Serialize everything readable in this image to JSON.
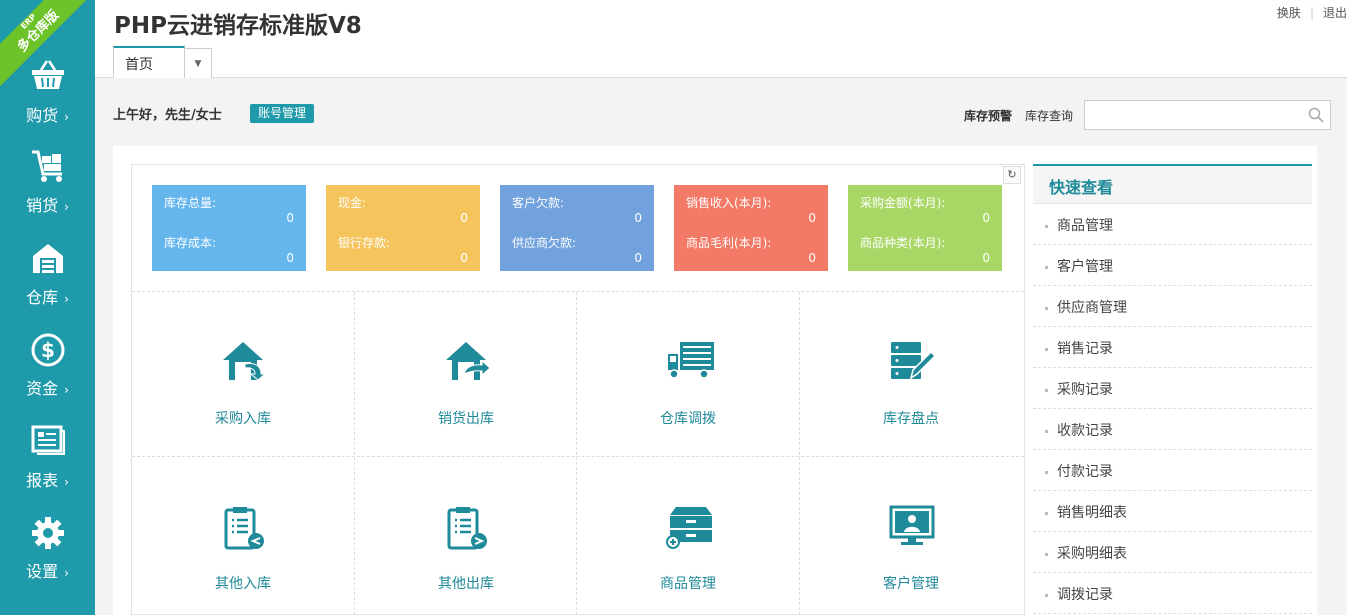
{
  "app": {
    "title": "PHP云进销存标准版V8"
  },
  "ribbon": {
    "small": "ERP",
    "big": "多仓库版"
  },
  "sidebar": {
    "items": [
      {
        "label": "购货",
        "icon": "basket-icon"
      },
      {
        "label": "销货",
        "icon": "cart-icon"
      },
      {
        "label": "仓库",
        "icon": "warehouse-icon"
      },
      {
        "label": "资金",
        "icon": "dollar-icon"
      },
      {
        "label": "报表",
        "icon": "report-icon"
      },
      {
        "label": "设置",
        "icon": "gear-icon"
      }
    ]
  },
  "header": {
    "skin": "换肤",
    "logout": "退出"
  },
  "tabs": {
    "home": "首页"
  },
  "greeting": {
    "text": "上午好，先生/女士",
    "account": "账号管理"
  },
  "stock": {
    "warning": "库存预警",
    "query_label": "库存查询",
    "query_value": ""
  },
  "stats": [
    {
      "label1": "库存总量:",
      "value1": "0",
      "label2": "库存成本:",
      "value2": "0",
      "color": "#66b6ee"
    },
    {
      "label1": "现金:",
      "value1": "0",
      "label2": "银行存款:",
      "value2": "0",
      "color": "#f5c45c"
    },
    {
      "label1": "客户欠款:",
      "value1": "0",
      "label2": "供应商欠款:",
      "value2": "0",
      "color": "#71a2dd"
    },
    {
      "label1": "销售收入(本月):",
      "value1": "0",
      "label2": "商品毛利(本月):",
      "value2": "0",
      "color": "#f27a67"
    },
    {
      "label1": "采购金额(本月):",
      "value1": "0",
      "label2": "商品种类(本月):",
      "value2": "0",
      "color": "#a9d766"
    }
  ],
  "shortcuts": [
    {
      "label": "采购入库",
      "icon": "purchase-in-icon"
    },
    {
      "label": "销货出库",
      "icon": "sales-out-icon"
    },
    {
      "label": "仓库调拨",
      "icon": "truck-icon"
    },
    {
      "label": "库存盘点",
      "icon": "inventory-check-icon"
    },
    {
      "label": "其他入库",
      "icon": "clipboard-in-icon"
    },
    {
      "label": "其他出库",
      "icon": "clipboard-out-icon"
    },
    {
      "label": "商品管理",
      "icon": "product-box-icon"
    },
    {
      "label": "客户管理",
      "icon": "customer-monitor-icon"
    }
  ],
  "quick": {
    "title": "快速查看",
    "items": [
      "商品管理",
      "客户管理",
      "供应商管理",
      "销售记录",
      "采购记录",
      "收款记录",
      "付款记录",
      "销售明细表",
      "采购明细表",
      "调拨记录"
    ]
  },
  "colors": {
    "accent": "#1f9aaa",
    "ribbon": "#6cc329"
  }
}
